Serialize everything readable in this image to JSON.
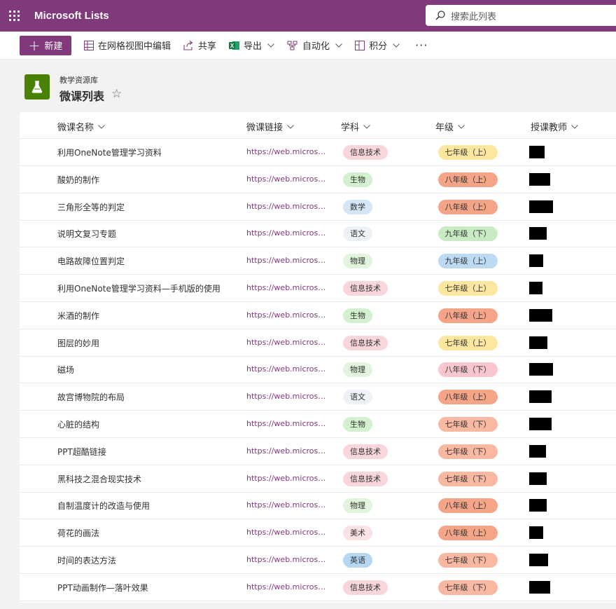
{
  "app": {
    "name": "Microsoft Lists"
  },
  "search": {
    "placeholder": "搜索此列表"
  },
  "toolbar": {
    "new_label": "新建",
    "grid_edit_label": "在网格视图中编辑",
    "share_label": "共享",
    "export_label": "导出",
    "automate_label": "自动化",
    "integrate_label": "积分",
    "more_label": "···"
  },
  "header": {
    "site_name": "教学资源库",
    "list_title": "微课列表",
    "favorite_glyph": "☆"
  },
  "columns": {
    "title": "微课名称",
    "link": "微课链接",
    "subject": "学科",
    "grade": "年级",
    "teacher": "授课教师"
  },
  "rows": [
    {
      "title": "利用OneNote管理学习资料",
      "link": "https://web.microsoftstream.com",
      "subject": "信息技术",
      "grade": "七年级（上）"
    },
    {
      "title": "酸奶的制作",
      "link": "https://web.microsoftstream.com",
      "subject": "生物",
      "grade": "八年级（上）"
    },
    {
      "title": "三角形全等的判定",
      "link": "https://web.microsoftstream.com",
      "subject": "数学",
      "grade": "八年级（上）"
    },
    {
      "title": "说明文复习专题",
      "link": "https://web.microsoftstream.com",
      "subject": "语文",
      "grade": "九年级（下）"
    },
    {
      "title": "电路故障位置判定",
      "link": "https://web.microsoftstream.com",
      "subject": "物理",
      "grade": "九年级（上）"
    },
    {
      "title": "利用OneNote管理学习资料—手机版的使用",
      "link": "https://web.microsoftstream.com",
      "subject": "信息技术",
      "grade": "七年级（上）"
    },
    {
      "title": "米酒的制作",
      "link": "https://web.microsoftstream.com",
      "subject": "生物",
      "grade": "八年级（上）"
    },
    {
      "title": "图层的妙用",
      "link": "https://web.microsoftstream.com",
      "subject": "信息技术",
      "grade": "七年级（上）"
    },
    {
      "title": "磁场",
      "link": "https://web.microsoftstream.com",
      "subject": "物理",
      "grade": "八年级（下）"
    },
    {
      "title": "故宫博物院的布局",
      "link": "https://web.microsoftstream.com",
      "subject": "语文",
      "grade": "八年级（上）"
    },
    {
      "title": "心脏的结构",
      "link": "https://web.microsoftstream.com",
      "subject": "生物",
      "grade": "七年级（下）"
    },
    {
      "title": "PPT超酷链接",
      "link": "https://web.microsoftstream.com",
      "subject": "信息技术",
      "grade": "七年级（下）"
    },
    {
      "title": "黑科技之混合现实技术",
      "link": "https://web.microsoftstream.com",
      "subject": "信息技术",
      "grade": "七年级（下）"
    },
    {
      "title": "自制温度计的改造与使用",
      "link": "https://web.microsoftstream.com",
      "subject": "物理",
      "grade": "八年级（上）"
    },
    {
      "title": "荷花的画法",
      "link": "https://web.microsoftstream.com",
      "subject": "美术",
      "grade": "八年级（上）"
    },
    {
      "title": "时间的表达方法",
      "link": "https://web.microsoftstream.com",
      "subject": "英语",
      "grade": "七年级（下）"
    },
    {
      "title": "PPT动画制作—落叶效果",
      "link": "https://web.microsoftstream.com",
      "subject": "信息技术",
      "grade": "七年级（下）"
    }
  ],
  "colors": {
    "brand": "#80397b",
    "subject": {
      "信息技术": "#f9d6dc",
      "生物": "#d3f0d0",
      "数学": "#d4e6f7",
      "语文": "#eef2f7",
      "物理": "#e1f5dc",
      "美术": "#fbe2e4",
      "英语": "#b6d7f2"
    },
    "grade": {
      "七年级（上）": "#fde7a0",
      "八年级（上）": "#f6a487",
      "九年级（下）": "#c8ebc4",
      "九年级（上）": "#bcdaf3",
      "八年级（下）": "#f9c6ce",
      "七年级（下）": "#f8b8a2"
    }
  },
  "icons": {
    "waffle": "waffle-icon",
    "search": "search-icon",
    "grid": "grid-view-icon",
    "share": "share-icon",
    "excel": "excel-icon",
    "automate": "automate-icon",
    "integrate": "integrate-icon",
    "list": "flask-icon",
    "chevron": "chevron-down-icon"
  }
}
